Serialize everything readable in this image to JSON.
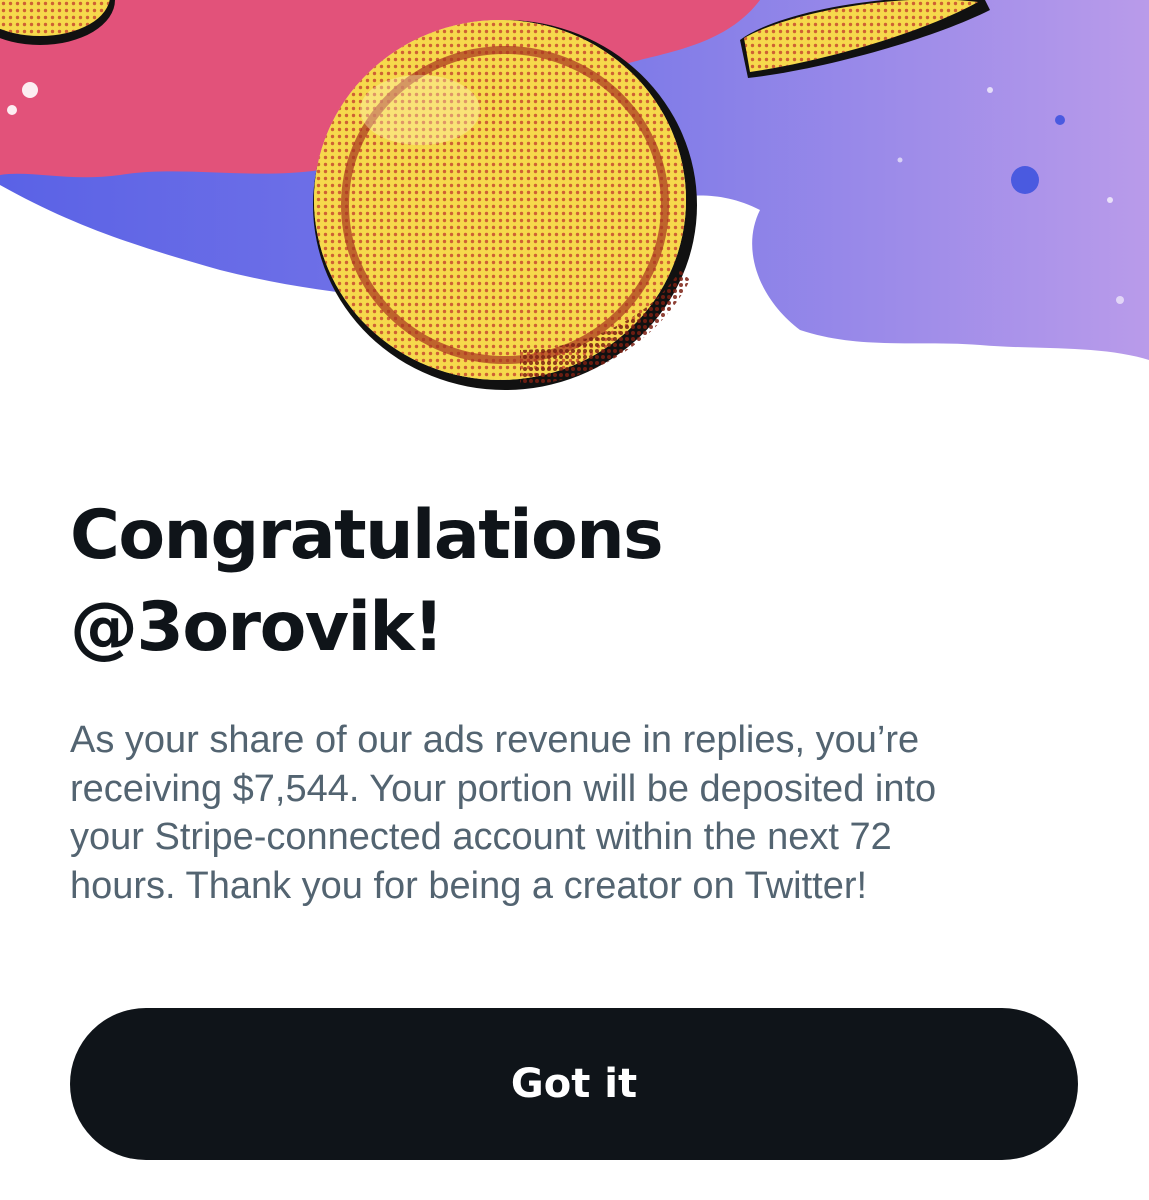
{
  "dialog": {
    "title_line1": "Congratulations",
    "title_line2": "@3orovik!",
    "body_lines": [
      "As your share of our ads revenue in replies, you’re",
      "receiving $7,544. Your portion will be deposited into",
      "your Stripe-connected account within the next 72",
      "hours. Thank you for being a creator on Twitter!"
    ],
    "button_label": "Got it"
  },
  "colors": {
    "text_primary": "#0f1419",
    "text_secondary": "#536471",
    "button_bg": "#0f1419",
    "button_text": "#ffffff",
    "hero_pink": "#e2527a",
    "hero_blue": "#4a5ae0",
    "hero_lavender": "#a58ce8",
    "coin_yellow": "#f6d94c"
  },
  "icons": {
    "hero": "coins-illustration"
  }
}
